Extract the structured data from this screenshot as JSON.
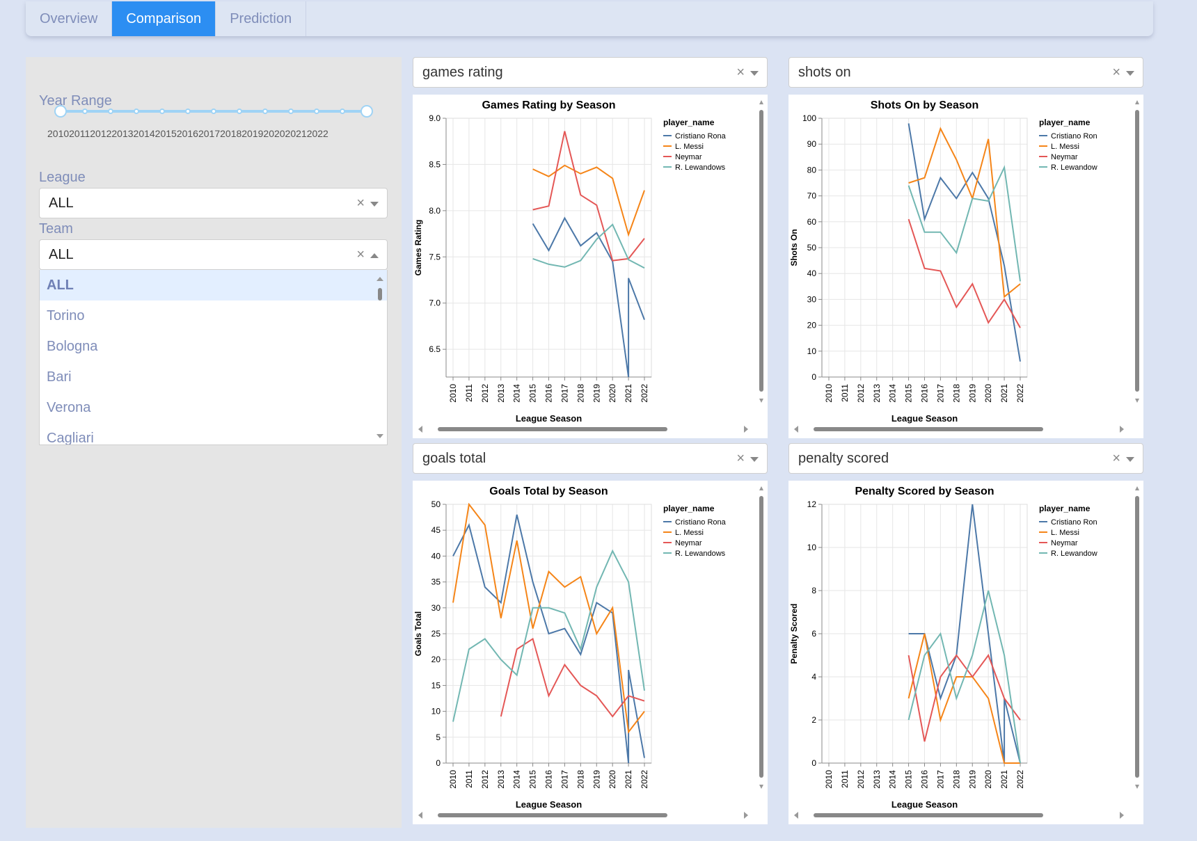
{
  "tabs": [
    {
      "label": "Overview",
      "active": false
    },
    {
      "label": "Comparison",
      "active": true
    },
    {
      "label": "Prediction",
      "active": false
    }
  ],
  "sidebar": {
    "year_range_label": "Year Range",
    "year_ticks": "20102011201220132014201520162017201820192020202120222",
    "year_ticks_text": "2010201120122013201420152016201720182019202020212022",
    "league_label": "League",
    "league_value": "ALL",
    "team_label": "Team",
    "team_value": "ALL",
    "team_options": [
      "ALL",
      "Torino",
      "Bologna",
      "Bari",
      "Verona",
      "Cagliari"
    ]
  },
  "colors": {
    "accent": "#2c8ef2",
    "series": [
      "#4c78a8",
      "#f58518",
      "#e45756",
      "#72b7b2"
    ]
  },
  "chart_data": [
    {
      "selector": "games rating",
      "type": "line",
      "title": "Games Rating by Season",
      "xlabel": "League Season",
      "ylabel": "Games Rating",
      "legend_title": "player_name",
      "ylim": [
        6.2,
        9.0
      ],
      "yticks": [
        6.5,
        7.0,
        7.5,
        8.0,
        8.5,
        9.0
      ],
      "ytick_labels": [
        "6.5",
        "7.0",
        "7.5",
        "8.0",
        "8.5",
        "9.0"
      ],
      "x": [
        2010,
        2011,
        2012,
        2013,
        2014,
        2015,
        2016,
        2017,
        2018,
        2019,
        2020,
        2021,
        2022
      ],
      "series": [
        {
          "name": "Cristiano Ronaldo",
          "legend": "Cristiano Rona",
          "points": [
            [
              2015,
              7.86
            ],
            [
              2016,
              7.57
            ],
            [
              2017,
              7.92
            ],
            [
              2018,
              7.62
            ],
            [
              2019,
              7.76
            ],
            [
              2020,
              7.45
            ],
            [
              2021,
              6.2
            ],
            [
              2021,
              7.27
            ],
            [
              2022,
              6.82
            ]
          ]
        },
        {
          "name": "L. Messi",
          "legend": "L. Messi",
          "points": [
            [
              2015,
              8.45
            ],
            [
              2016,
              8.37
            ],
            [
              2017,
              8.49
            ],
            [
              2018,
              8.4
            ],
            [
              2019,
              8.47
            ],
            [
              2020,
              8.35
            ],
            [
              2021,
              7.74
            ],
            [
              2022,
              8.22
            ]
          ]
        },
        {
          "name": "Neymar",
          "legend": "Neymar",
          "points": [
            [
              2015,
              8.01
            ],
            [
              2016,
              8.05
            ],
            [
              2017,
              8.86
            ],
            [
              2018,
              8.17
            ],
            [
              2019,
              8.06
            ],
            [
              2020,
              7.46
            ],
            [
              2021,
              7.48
            ],
            [
              2022,
              7.7
            ]
          ]
        },
        {
          "name": "R. Lewandowski",
          "legend": "R. Lewandows",
          "points": [
            [
              2015,
              7.48
            ],
            [
              2016,
              7.42
            ],
            [
              2017,
              7.39
            ],
            [
              2018,
              7.46
            ],
            [
              2019,
              7.69
            ],
            [
              2020,
              7.85
            ],
            [
              2021,
              7.47
            ],
            [
              2022,
              7.38
            ]
          ]
        }
      ]
    },
    {
      "selector": "shots on",
      "type": "line",
      "title": "Shots On by Season",
      "xlabel": "League Season",
      "ylabel": "Shots On",
      "legend_title": "player_name",
      "ylim": [
        0,
        100
      ],
      "yticks": [
        0,
        10,
        20,
        30,
        40,
        50,
        60,
        70,
        80,
        90,
        100
      ],
      "ytick_labels": [
        "0",
        "10",
        "20",
        "30",
        "40",
        "50",
        "60",
        "70",
        "80",
        "90",
        "100"
      ],
      "x": [
        2010,
        2011,
        2012,
        2013,
        2014,
        2015,
        2016,
        2017,
        2018,
        2019,
        2020,
        2021,
        2022
      ],
      "series": [
        {
          "name": "Cristiano Ronaldo",
          "legend": "Cristiano Ron",
          "points": [
            [
              2015,
              98
            ],
            [
              2016,
              61
            ],
            [
              2017,
              77
            ],
            [
              2018,
              69
            ],
            [
              2019,
              79
            ],
            [
              2020,
              69
            ],
            [
              2021,
              43
            ],
            [
              2022,
              6
            ]
          ]
        },
        {
          "name": "L. Messi",
          "legend": "L. Messi",
          "points": [
            [
              2015,
              75
            ],
            [
              2016,
              77
            ],
            [
              2017,
              96
            ],
            [
              2018,
              84
            ],
            [
              2019,
              69
            ],
            [
              2020,
              92
            ],
            [
              2021,
              31
            ],
            [
              2022,
              36
            ]
          ]
        },
        {
          "name": "Neymar",
          "legend": "Neymar",
          "points": [
            [
              2015,
              61
            ],
            [
              2016,
              42
            ],
            [
              2017,
              41
            ],
            [
              2018,
              27
            ],
            [
              2019,
              36
            ],
            [
              2020,
              21
            ],
            [
              2021,
              30
            ],
            [
              2022,
              19
            ]
          ]
        },
        {
          "name": "R. Lewandowski",
          "legend": "R. Lewandow",
          "points": [
            [
              2015,
              74
            ],
            [
              2016,
              56
            ],
            [
              2017,
              56
            ],
            [
              2018,
              48
            ],
            [
              2019,
              69
            ],
            [
              2020,
              68
            ],
            [
              2021,
              81
            ],
            [
              2022,
              37
            ]
          ]
        }
      ]
    },
    {
      "selector": "goals total",
      "type": "line",
      "title": "Goals Total by Season",
      "xlabel": "League Season",
      "ylabel": "Goals Total",
      "legend_title": "player_name",
      "ylim": [
        0,
        50
      ],
      "yticks": [
        0,
        5,
        10,
        15,
        20,
        25,
        30,
        35,
        40,
        45,
        50
      ],
      "ytick_labels": [
        "0",
        "5",
        "10",
        "15",
        "20",
        "25",
        "30",
        "35",
        "40",
        "45",
        "50"
      ],
      "x": [
        2010,
        2011,
        2012,
        2013,
        2014,
        2015,
        2016,
        2017,
        2018,
        2019,
        2020,
        2021,
        2022
      ],
      "series": [
        {
          "name": "Cristiano Ronaldo",
          "legend": "Cristiano Rona",
          "points": [
            [
              2010,
              40
            ],
            [
              2011,
              46
            ],
            [
              2012,
              34
            ],
            [
              2013,
              31
            ],
            [
              2014,
              48
            ],
            [
              2015,
              35
            ],
            [
              2016,
              25
            ],
            [
              2017,
              26
            ],
            [
              2018,
              21
            ],
            [
              2019,
              31
            ],
            [
              2020,
              29
            ],
            [
              2021,
              0
            ],
            [
              2021,
              18
            ],
            [
              2022,
              1
            ]
          ]
        },
        {
          "name": "L. Messi",
          "legend": "L. Messi",
          "points": [
            [
              2010,
              31
            ],
            [
              2011,
              50
            ],
            [
              2012,
              46
            ],
            [
              2013,
              28
            ],
            [
              2014,
              43
            ],
            [
              2015,
              26
            ],
            [
              2016,
              37
            ],
            [
              2017,
              34
            ],
            [
              2018,
              36
            ],
            [
              2019,
              25
            ],
            [
              2020,
              30
            ],
            [
              2021,
              6
            ],
            [
              2022,
              10
            ]
          ]
        },
        {
          "name": "Neymar",
          "legend": "Neymar",
          "points": [
            [
              2013,
              9
            ],
            [
              2014,
              22
            ],
            [
              2015,
              24
            ],
            [
              2016,
              13
            ],
            [
              2017,
              19
            ],
            [
              2018,
              15
            ],
            [
              2019,
              13
            ],
            [
              2020,
              9
            ],
            [
              2021,
              13
            ],
            [
              2022,
              12
            ]
          ]
        },
        {
          "name": "R. Lewandowski",
          "legend": "R. Lewandows",
          "points": [
            [
              2010,
              8
            ],
            [
              2011,
              22
            ],
            [
              2012,
              24
            ],
            [
              2013,
              20
            ],
            [
              2014,
              17
            ],
            [
              2015,
              30
            ],
            [
              2016,
              30
            ],
            [
              2017,
              29
            ],
            [
              2018,
              22
            ],
            [
              2019,
              34
            ],
            [
              2020,
              41
            ],
            [
              2021,
              35
            ],
            [
              2022,
              14
            ]
          ]
        }
      ]
    },
    {
      "selector": "penalty scored",
      "type": "line",
      "title": "Penalty Scored by Season",
      "xlabel": "League Season",
      "ylabel": "Penalty Scored",
      "legend_title": "player_name",
      "ylim": [
        0,
        12
      ],
      "yticks": [
        0,
        2,
        4,
        6,
        8,
        10,
        12
      ],
      "ytick_labels": [
        "0",
        "2",
        "4",
        "6",
        "8",
        "10",
        "12"
      ],
      "x": [
        2010,
        2011,
        2012,
        2013,
        2014,
        2015,
        2016,
        2017,
        2018,
        2019,
        2020,
        2021,
        2022
      ],
      "series": [
        {
          "name": "Cristiano Ronaldo",
          "legend": "Cristiano Ron",
          "points": [
            [
              2015,
              6
            ],
            [
              2016,
              6
            ],
            [
              2017,
              3
            ],
            [
              2018,
              5
            ],
            [
              2019,
              12
            ],
            [
              2020,
              6
            ],
            [
              2021,
              0
            ],
            [
              2021,
              3
            ],
            [
              2022,
              0
            ]
          ]
        },
        {
          "name": "L. Messi",
          "legend": "L. Messi",
          "points": [
            [
              2015,
              3
            ],
            [
              2016,
              6
            ],
            [
              2017,
              2
            ],
            [
              2018,
              4
            ],
            [
              2019,
              4
            ],
            [
              2020,
              3
            ],
            [
              2021,
              0
            ],
            [
              2022,
              0
            ]
          ]
        },
        {
          "name": "Neymar",
          "legend": "Neymar",
          "points": [
            [
              2015,
              5
            ],
            [
              2016,
              1
            ],
            [
              2017,
              4
            ],
            [
              2018,
              5
            ],
            [
              2019,
              4
            ],
            [
              2020,
              5
            ],
            [
              2021,
              3
            ],
            [
              2022,
              2
            ]
          ]
        },
        {
          "name": "R. Lewandowski",
          "legend": "R. Lewandow",
          "points": [
            [
              2015,
              2
            ],
            [
              2016,
              5
            ],
            [
              2017,
              6
            ],
            [
              2018,
              3
            ],
            [
              2019,
              5
            ],
            [
              2020,
              8
            ],
            [
              2021,
              5
            ],
            [
              2022,
              0
            ]
          ]
        }
      ]
    }
  ]
}
